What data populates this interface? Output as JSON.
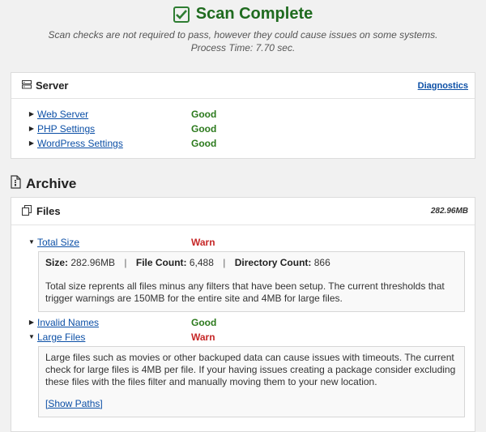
{
  "header": {
    "title": "Scan Complete",
    "subtitle": "Scan checks are not required to pass, however they could cause issues on some systems.",
    "process_time": "Process Time: 7.70 sec."
  },
  "server": {
    "title": "Server",
    "link": "Diagnostics",
    "rows": [
      {
        "name": "Web Server",
        "status": "Good"
      },
      {
        "name": "PHP Settings",
        "status": "Good"
      },
      {
        "name": "WordPress Settings",
        "status": "Good"
      }
    ]
  },
  "archive": {
    "title": "Archive"
  },
  "files": {
    "title": "Files",
    "size": "282.96MB",
    "total_size": {
      "name": "Total Size",
      "status": "Warn",
      "size_label": "Size:",
      "size_value": "282.96MB",
      "count_label": "File Count:",
      "count_value": "6,488",
      "dir_label": "Directory Count:",
      "dir_value": "866",
      "description": "Total size reprents all files minus any filters that have been setup. The current thresholds that trigger warnings are 150MB for the entire site and 4MB for large files."
    },
    "invalid_names": {
      "name": "Invalid Names",
      "status": "Good"
    },
    "large_files": {
      "name": "Large Files",
      "status": "Warn",
      "description": "Large files such as movies or other backuped data can cause issues with timeouts. The current check for large files is 4MB per file. If your having issues creating a package consider excluding these files with the files filter and manually moving them to your new location.",
      "show_paths": "[Show Paths]"
    }
  },
  "colors": {
    "good": "#2c7a1d",
    "warn": "#c62828",
    "link": "#0b4fa6",
    "title": "#1f6b1f"
  }
}
